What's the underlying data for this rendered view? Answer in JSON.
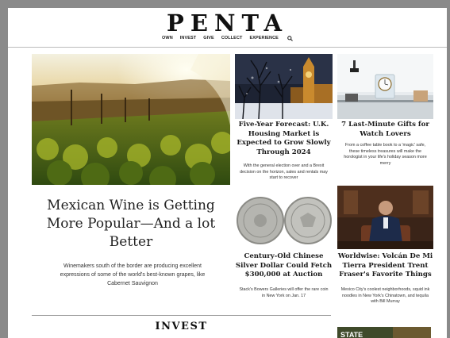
{
  "brand": {
    "logo": "PENTA"
  },
  "nav": {
    "items": [
      "OWN",
      "INVEST",
      "GIVE",
      "COLLECT",
      "EXPERIENCE"
    ],
    "search_icon": "search-icon"
  },
  "hero": {
    "title": "Mexican Wine is Getting More Popular—And a lot Better",
    "dek": "Winemakers south of the border are producing excellent expressions of some of the world's best-known grapes, like Cabernet Sauvignon"
  },
  "cards": [
    {
      "title": "Five-Year Forecast: U.K. Housing Market is Expected to Grow Slowly Through 2024",
      "dek": "With the general election over and a Brexit decision on the horizon, sales and rentals may start to recover"
    },
    {
      "title": "7 Last-Minute Gifts for Watch Lovers",
      "dek": "From a coffee table book to a 'magic' safe, these timeless treasures will make the horologist in your life's holiday season more merry"
    },
    {
      "title": "Century-Old Chinese Silver Dollar Could Fetch $300,000 at Auction",
      "dek": "Stack's Bowers Galleries will offer the rare coin in New York on Jan. 17"
    },
    {
      "title": "Worldwise: Volcán De Mi Tierra President Trent Fraser's Favorite Things",
      "dek": "Mexico City's coolest neighborhoods, squid ink noodles in New York's Chinatown, and tequila with Bill Murray"
    }
  ],
  "section": {
    "label": "INVEST"
  },
  "thumb_label": "STATE",
  "colors": {
    "page_bg": "#ffffff",
    "frame": "#8a8a8a",
    "text": "#1a1a1a"
  }
}
